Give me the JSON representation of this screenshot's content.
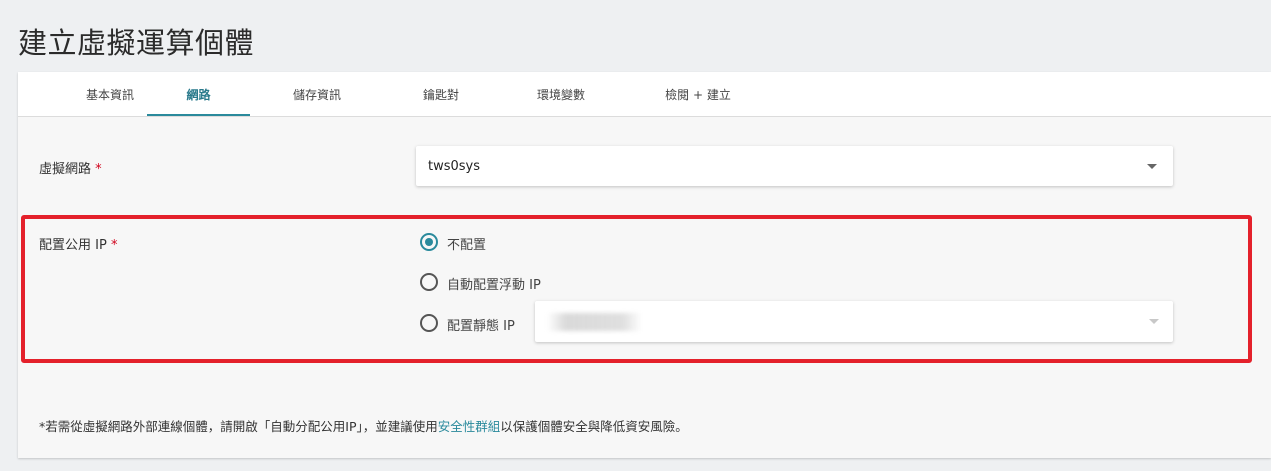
{
  "page": {
    "title": "建立虛擬運算個體"
  },
  "tabs": [
    {
      "label": "基本資訊",
      "active": false
    },
    {
      "label": "網路",
      "active": true
    },
    {
      "label": "儲存資訊",
      "active": false
    },
    {
      "label": "鑰匙對",
      "active": false
    },
    {
      "label": "環境變數",
      "active": false
    },
    {
      "label": "檢閱 + 建立",
      "active": false
    }
  ],
  "virtual_network": {
    "label": "虛擬網路",
    "required_mark": "*",
    "selected_value": "tws0sys"
  },
  "public_ip": {
    "label": "配置公用 IP",
    "required_mark": "*",
    "options": [
      {
        "label": "不配置",
        "checked": true
      },
      {
        "label": "自動配置浮動 IP",
        "checked": false
      },
      {
        "label": "配置靜態 IP",
        "checked": false
      }
    ]
  },
  "footnote": {
    "prefix": "*若需從虛擬網路外部連線個體，請開啟「自動分配公用IP」，並建議使用",
    "link_text": "安全性群組",
    "suffix": "以保護個體安全與降低資安風險。"
  },
  "colors": {
    "accent": "#2a8a9c",
    "required": "#d0021b",
    "highlight_border": "#e4212b",
    "page_background": "#eef0f2"
  }
}
